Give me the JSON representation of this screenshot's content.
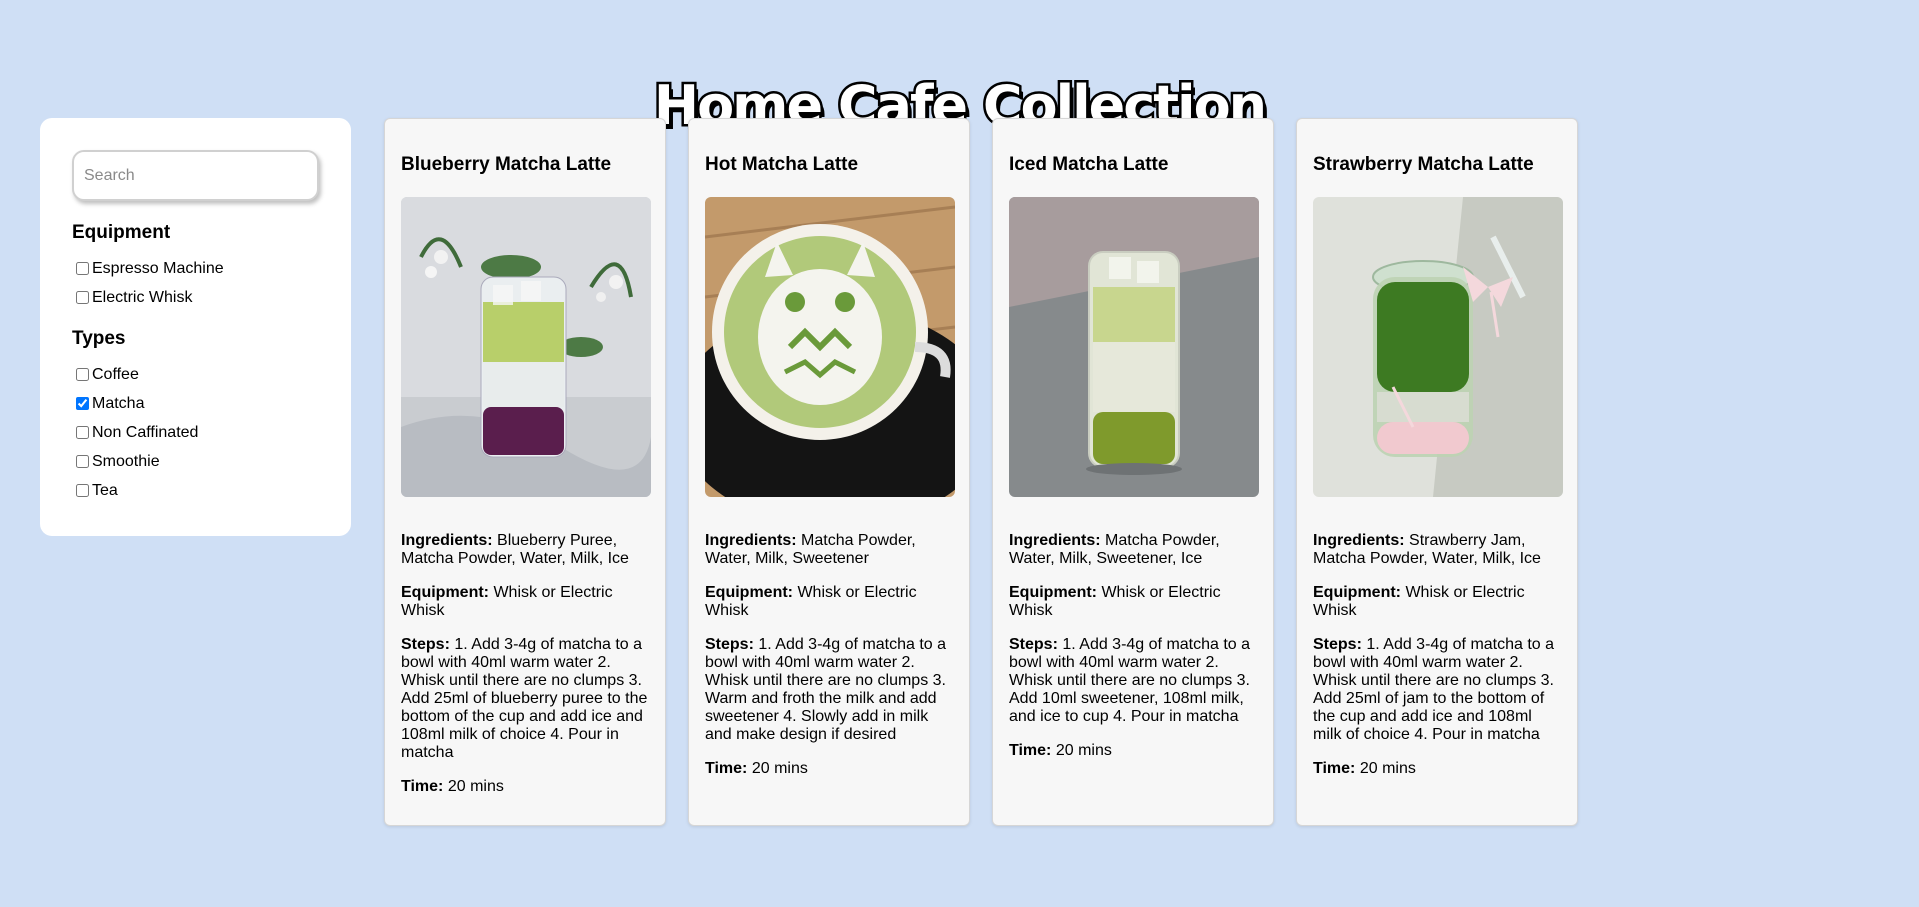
{
  "page": {
    "title": "Home Cafe Collection"
  },
  "sidebar": {
    "search_placeholder": "Search",
    "equipment_heading": "Equipment",
    "equipment": [
      {
        "label": "Espresso Machine",
        "checked": false
      },
      {
        "label": "Electric Whisk",
        "checked": false
      }
    ],
    "types_heading": "Types",
    "types": [
      {
        "label": "Coffee",
        "checked": false
      },
      {
        "label": "Matcha",
        "checked": true
      },
      {
        "label": "Non Caffinated",
        "checked": false
      },
      {
        "label": "Smoothie",
        "checked": false
      },
      {
        "label": "Tea",
        "checked": false
      }
    ]
  },
  "labels": {
    "ingredients": "Ingredients:",
    "equipment": "Equipment:",
    "steps": "Steps:",
    "time": "Time:"
  },
  "recipes": [
    {
      "name": "Blueberry Matcha Latte",
      "image": "blueberry-matcha-latte-photo",
      "ingredients": "Blueberry Puree, Matcha Powder, Water, Milk, Ice",
      "equipment": "Whisk or Electric Whisk",
      "steps": "1. Add 3-4g of matcha to a bowl with 40ml warm water 2. Whisk until there are no clumps 3. Add 25ml of blueberry puree to the bottom of the cup and add ice and 108ml milk of choice 4. Pour in matcha",
      "time": "20 mins"
    },
    {
      "name": "Hot Matcha Latte",
      "image": "hot-matcha-latte-photo",
      "ingredients": "Matcha Powder, Water, Milk, Sweetener",
      "equipment": "Whisk or Electric Whisk",
      "steps": "1. Add 3-4g of matcha to a bowl with 40ml warm water 2. Whisk until there are no clumps 3. Warm and froth the milk and add sweetener 4. Slowly add in milk and make design if desired",
      "time": "20 mins"
    },
    {
      "name": "Iced Matcha Latte",
      "image": "iced-matcha-latte-photo",
      "ingredients": "Matcha Powder, Water, Milk, Sweetener, Ice",
      "equipment": "Whisk or Electric Whisk",
      "steps": "1. Add 3-4g of matcha to a bowl with 40ml warm water 2. Whisk until there are no clumps 3. Add 10ml sweetener, 108ml milk, and ice to cup 4. Pour in matcha",
      "time": "20 mins"
    },
    {
      "name": "Strawberry Matcha Latte",
      "image": "strawberry-matcha-latte-photo",
      "ingredients": "Strawberry Jam, Matcha Powder, Water, Milk, Ice",
      "equipment": "Whisk or Electric Whisk",
      "steps": "1. Add 3-4g of matcha to a bowl with 40ml warm water 2. Whisk until there are no clumps 3. Add 25ml of jam to the bottom of the cup and add ice and 108ml milk of choice 4. Pour in matcha",
      "time": "20 mins"
    }
  ],
  "colors": {
    "background": "#cfdff5",
    "card": "#f7f7f7",
    "checkbox_accent": "#1a73e8"
  }
}
